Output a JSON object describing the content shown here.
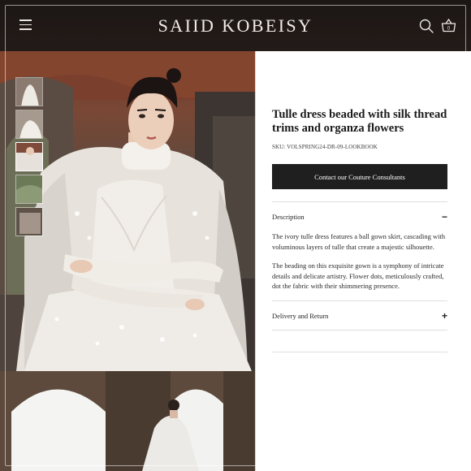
{
  "header": {
    "brand": "SAIID KOBEISY",
    "menu_icon": "hamburger-menu-icon",
    "search_icon": "search-icon",
    "basket_icon": "shopping-basket-icon",
    "cart_count": "0"
  },
  "gallery": {
    "thumbnails": [
      "thumb-1",
      "thumb-2",
      "thumb-3",
      "thumb-4",
      "thumb-5"
    ],
    "active_index": 2
  },
  "product": {
    "title": "Tulle dress beaded with silk thread trims and organza flowers",
    "sku": "SKU: VOLSPRING24-DR-09-LOOKBOOK",
    "contact_button": "Contact our Couture Consultants",
    "description_label": "Description",
    "description_sign": "−",
    "description_p1": "The ivory tulle dress features a ball gown skirt, cascading with voluminous layers of tulle that create a majestic silhouette.",
    "description_p2": "The beading on this exquisite gown is a symphony of intricate details and delicate artistry. Flower dots, meticulously crafted, dot the fabric with their shimmering presence.",
    "delivery_label": "Delivery and Return",
    "delivery_sign": "+"
  },
  "colors": {
    "header_bg": "#1c1614",
    "button_bg": "#1f1f1f",
    "panel_bg": "#ffffff"
  }
}
